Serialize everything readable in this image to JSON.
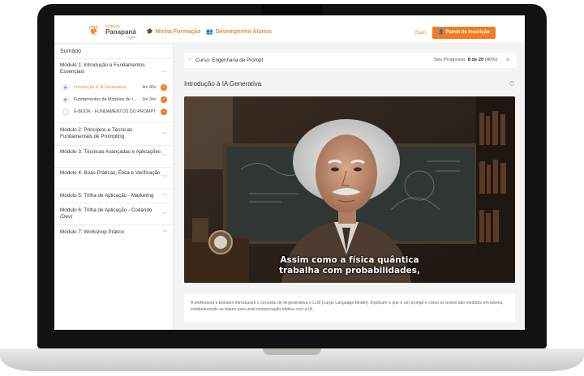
{
  "nav": {
    "logo": {
      "line1": "Instituto",
      "line2": "Panapaná",
      "line3": "Digital"
    },
    "links": [
      {
        "icon": "graduation-icon",
        "label": "Minha Formação"
      },
      {
        "icon": "users-icon",
        "label": "Desempenho Alunos"
      }
    ],
    "logout": "(Sair)",
    "panel_button": "Painel de Inscrição"
  },
  "sidebar": {
    "title": "Sumário",
    "module1": {
      "label": "Módulo 1: Introdução e Fundamentos Essenciais",
      "lessons": [
        {
          "title": "Introdução à IA Generativa",
          "duration": "4m 40s",
          "done": true,
          "active": true
        },
        {
          "title": "Fundamentos de Modelos de I...",
          "duration": "3m 34s",
          "done": true,
          "active": false
        },
        {
          "title": "E-BOOK - FUNDAMENTOS DO PROMPT",
          "duration": "",
          "done": true,
          "active": false
        }
      ]
    },
    "modules": [
      "Módulo 2: Princípios e Técnicas Fundamentais de Prompting",
      "Módulo 3: Técnicas Avançadas e Aplicações",
      "Módulo 4: Boas Práticas, Ética e Verificação",
      "Módulo 5: Trilha de Aplicação - Marketing",
      "Módulo 6: Trilha de Aplicação - Codando (Dev)",
      "Módulo 7: Workshop Prático"
    ]
  },
  "main": {
    "course": "Curso: Engenharia de Prompt",
    "progress_label": "Seu Progresso:",
    "progress_value": "8 de 20",
    "progress_pct": "(40%)",
    "progress_fraction": 0.4,
    "lesson_title": "Introdução à IA Generativa",
    "caption_line1": "Assim como a física quântica",
    "caption_line2": "trabalha com probabilidades,",
    "description": "A professora e Einstein introduzem o conceito de IA generativa e LLM (Large Language Model). Explicam o que é um prompt e como os textos são medidos em tokens, estabelecendo as bases para uma comunicação efetiva com a IA."
  },
  "colors": {
    "accent": "#f27c21",
    "text": "#333333"
  }
}
